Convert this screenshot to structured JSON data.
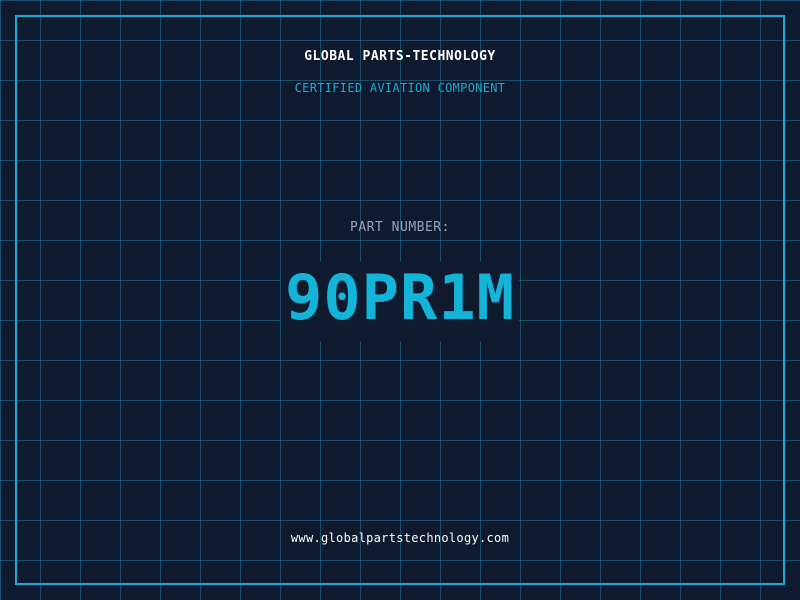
{
  "label": {
    "company": "GLOBAL PARTS-TECHNOLOGY",
    "subtitle": "CERTIFIED AVIATION COMPONENT",
    "part_label": "PART NUMBER:",
    "part_number": "90PR1M",
    "website": "www.globalpartstechnology.com"
  },
  "colors": {
    "background": "#101a2f",
    "grid": "#1e7896",
    "accent": "#1fa9cf",
    "part_number": "#14b3d8",
    "label_text": "#9aa4b8",
    "primary_text": "#ffffff"
  }
}
